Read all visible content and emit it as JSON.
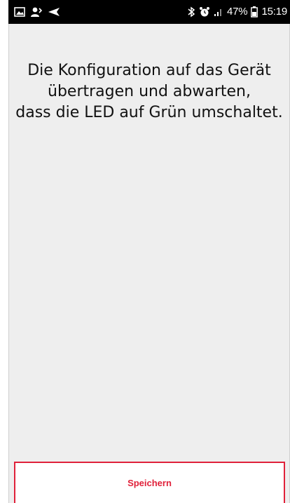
{
  "status_bar": {
    "icons_left": [
      "image-icon",
      "user-silhouette-icon",
      "send-icon"
    ],
    "icons_right": [
      "bluetooth-icon",
      "alarm-icon",
      "signal-icon"
    ],
    "battery_percent": "47%",
    "battery_icon": "battery-icon",
    "time": "15:19"
  },
  "content": {
    "message_lines": [
      "Die Konfiguration auf das Gerät",
      "übertragen und abwarten,",
      "dass die LED auf Grün umschaltet."
    ]
  },
  "footer": {
    "save_label": "Speichern"
  },
  "colors": {
    "accent": "#e0213a",
    "background": "#eeeeee",
    "status_bar": "#000000"
  }
}
